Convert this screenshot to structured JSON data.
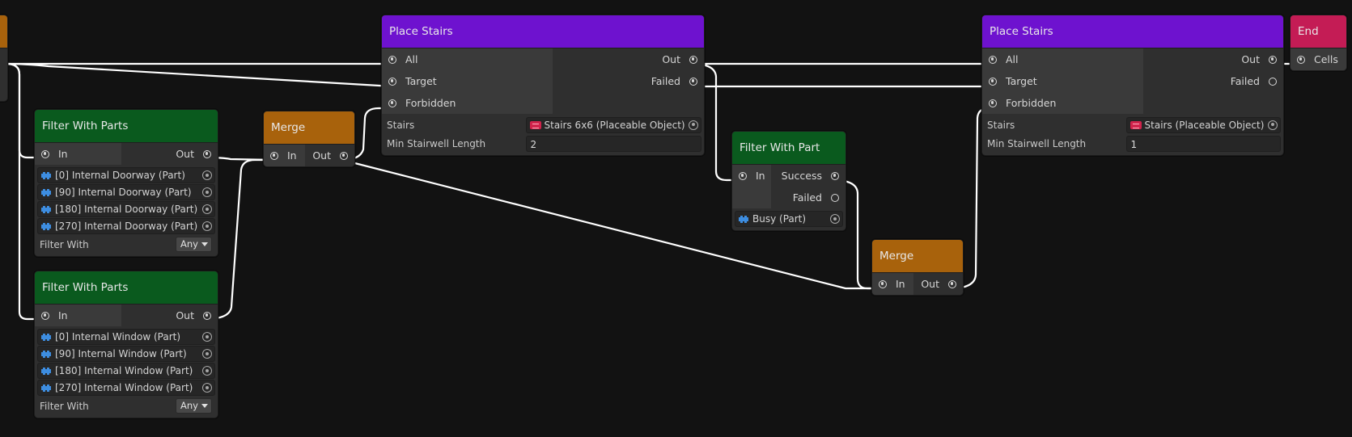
{
  "nodes": {
    "place_stairs_1": {
      "title": "Place Stairs",
      "inputs": [
        "All",
        "Target",
        "Forbidden"
      ],
      "outputs": [
        "Out",
        "Failed"
      ],
      "stairs_label": "Stairs",
      "stairs_value": "Stairs 6x6 (Placeable Object)",
      "min_label": "Min Stairwell Length",
      "min_value": "2"
    },
    "place_stairs_2": {
      "title": "Place Stairs",
      "inputs": [
        "All",
        "Target",
        "Forbidden"
      ],
      "outputs": [
        "Out",
        "Failed"
      ],
      "stairs_label": "Stairs",
      "stairs_value": "Stairs (Placeable Object)",
      "min_label": "Min Stairwell Length",
      "min_value": "1"
    },
    "end": {
      "title": "End",
      "input": "Cells"
    },
    "filter_doorway": {
      "title": "Filter With Parts",
      "input": "In",
      "output": "Out",
      "parts": [
        "[0] Internal Doorway (Part)",
        "[90] Internal Doorway (Part)",
        "[180] Internal Doorway (Part)",
        "[270] Internal Doorway (Part)"
      ],
      "filter_label": "Filter With",
      "filter_value": "Any"
    },
    "filter_window": {
      "title": "Filter With Parts",
      "input": "In",
      "output": "Out",
      "parts": [
        "[0] Internal Window (Part)",
        "[90] Internal Window (Part)",
        "[180] Internal Window (Part)",
        "[270] Internal Window (Part)"
      ],
      "filter_label": "Filter With",
      "filter_value": "Any"
    },
    "merge_1": {
      "title": "Merge",
      "input": "In",
      "output": "Out"
    },
    "merge_2": {
      "title": "Merge",
      "input": "In",
      "output": "Out"
    },
    "filter_part": {
      "title": "Filter With Part",
      "input": "In",
      "outputs": [
        "Success",
        "Failed"
      ],
      "part": "Busy (Part)"
    }
  },
  "colors": {
    "background": "#121212",
    "node_body": "#2f2f2f",
    "place_header": "#6e12cf",
    "filter_header": "#0a5a1e",
    "merge_header": "#a8620c",
    "end_header": "#c41c55",
    "wire": "#ffffff"
  }
}
